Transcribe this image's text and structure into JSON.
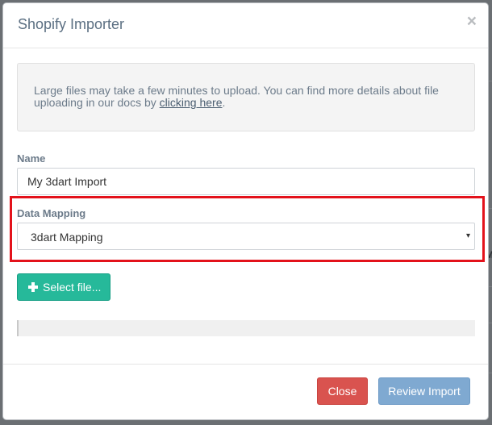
{
  "modal": {
    "title": "Shopify Importer",
    "close_glyph": "×"
  },
  "info": {
    "text": "Large files may take a few minutes to upload. You can find more details about file uploading in our docs by ",
    "link_text": "clicking here",
    "suffix": "."
  },
  "form": {
    "name_label": "Name",
    "name_value": "My 3dart Import",
    "mapping_label": "Data Mapping",
    "mapping_value": "3dart Mapping",
    "dropdown_arrow": "▾",
    "select_file_label": "Select file..."
  },
  "footer": {
    "close_label": "Close",
    "review_label": "Review Import"
  },
  "background": {
    "edge_letter": "M"
  },
  "colors": {
    "highlight": "#e3121b",
    "success": "#26b99a",
    "danger": "#d9534f",
    "primary_disabled": "#7fa9d1"
  }
}
